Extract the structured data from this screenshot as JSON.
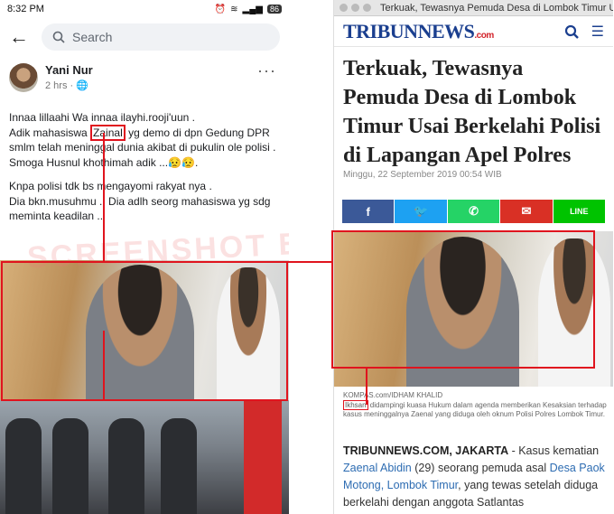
{
  "facebook": {
    "status_time": "8:32 PM",
    "battery": "86",
    "search_placeholder": "Search",
    "author": "Yani Nur",
    "post_time": "2 hrs · ",
    "more": "···",
    "lines": [
      "Innaa lillaahi Wa innaa ilayhi.rooji'uun .",
      "Adik mahasiswa ",
      "Zainal",
      " yg demo di dpn Gedung DPR",
      "smlm telah meninggal dunia  akibat di pukulin ole polisi .",
      "Smoga Husnul khothimah adik ...😥😥.",
      "Knpa polisi tdk bs mengayomi rakyat nya .",
      "Dia bkn.musuhmu .. Dia adlh seorg mahasiswa yg sdg meminta keadilan .."
    ],
    "watermark": "SCREENSHOT BY"
  },
  "tribun": {
    "tab_title": "Terkuak, Tewasnya Pemuda Desa di Lombok Timur Usai",
    "logo_main": "TRIBUNNEWS",
    "logo_sub": ".com",
    "headline": "Terkuak, Tewasnya Pemuda Desa di Lombok Timur Usai Berkelahi Polisi di Lapangan Apel Polres",
    "date": "Minggu, 22 September 2019 00:54 WIB",
    "share": [
      {
        "icon": "f",
        "color": "#3b5998"
      },
      {
        "icon": "🐦",
        "color": "#1da1f2"
      },
      {
        "icon": "✆",
        "color": "#25d366"
      },
      {
        "icon": "✉",
        "color": "#d93025"
      },
      {
        "icon": "LINE",
        "color": "#00c300"
      }
    ],
    "photo_credit": "KOMPAS.com/IDHAM KHALID",
    "caption_name": "Ikhsan",
    "caption_rest": " didampingi kuasa Hukum dalam agenda memberikan Kesaksian terhadap kasus meninggalnya Zaenal yang diduga oleh oknum Polisi Polres Lombok Timur.",
    "body_source": "TRIBUNNEWS.COM, JAKARTA",
    "body_1": " - Kasus kematian ",
    "link_1": "Zaenal Abidin",
    "body_2": " (29) seorang pemuda asal ",
    "link_2": "Desa Paok Motong, Lombok Timur",
    "body_3": ", yang tewas setelah diduga berkelahi dengan anggota Satlantas"
  }
}
